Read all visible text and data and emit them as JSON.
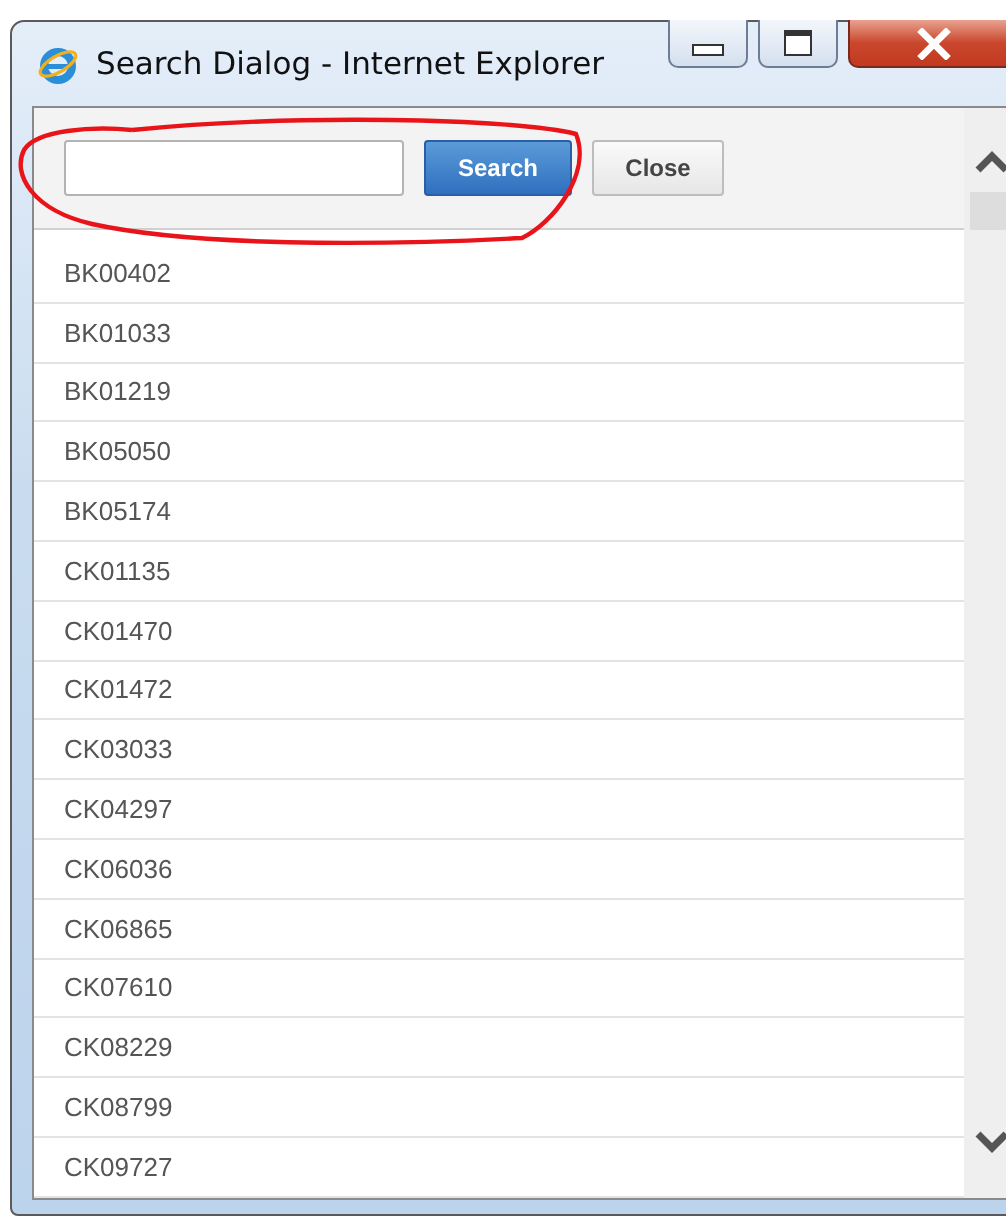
{
  "window": {
    "title": "Search Dialog - Internet Explorer"
  },
  "buttons": [
    {
      "label": "Search",
      "kind": "primary"
    },
    {
      "label": "Close",
      "kind": "secondary"
    }
  ],
  "results": [
    "BK00402",
    "BK01033",
    "BK01219",
    "BK05050",
    "BK05174",
    "CK01135",
    "CK01470",
    "CK01472",
    "CK03033",
    "CK04297",
    "CK06036",
    "CK06865",
    "CK07610",
    "CK08229",
    "CK08799",
    "CK09727"
  ]
}
